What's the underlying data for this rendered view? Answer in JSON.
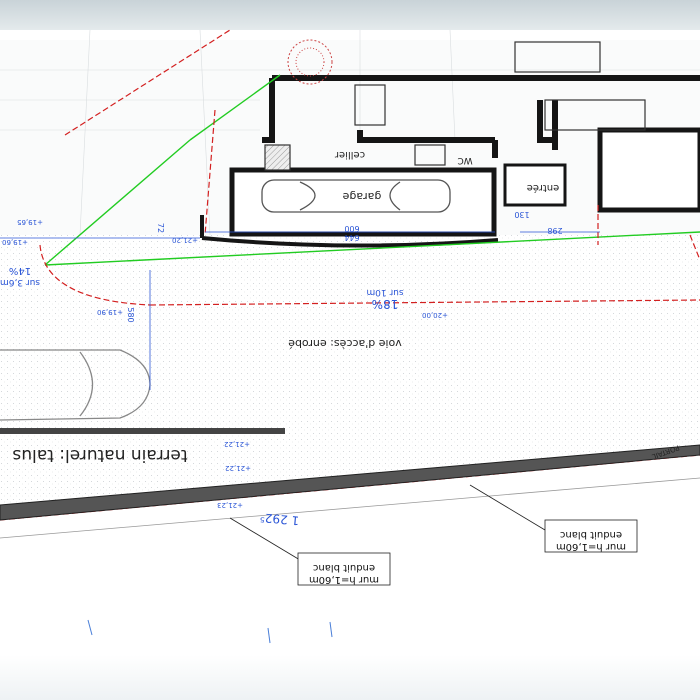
{
  "labels": {
    "garage": "garage",
    "cellier": "cellier",
    "wc": "WC",
    "entree": "entrée",
    "voie": "voie d'accès: enrobé",
    "terrain": "terrain naturel: talus",
    "portail": "PORTAIL",
    "slope1_pct": "18%",
    "slope1_len": "sur 10m",
    "slope2_pct": "14%",
    "slope2_len": "sur 3,6m",
    "dim_644": "644",
    "dim_600": "600",
    "dim_130": "130",
    "dim_298": "298",
    "dim_1292": "1 292⁵",
    "dim_580": "580",
    "dim_72": "72",
    "lvl_2122a": "+21,22",
    "lvl_2122b": "+21,22",
    "lvl_2120": "+21,20",
    "lvl_2123": "+21,23",
    "lvl_2000": "+20,00",
    "lvl_1965": "+19,65",
    "lvl_1990": "+19,90",
    "lvl_1960": "+19,60",
    "mur1_l1": "mur h=1,60m",
    "mur1_l2": "enduit blanc",
    "mur2_l1": "mur h=1,60m",
    "mur2_l2": "enduit blanc"
  },
  "colors": {
    "wall": "#151515",
    "green_line": "#22cc22",
    "red_dash": "#d32020",
    "dim_blue": "#2a55d6",
    "paving": "#cfd3d6"
  },
  "icons": {
    "car_garage": "car-outline-icon",
    "car_drive": "car-outline-icon",
    "tree": "tree-symbol-icon"
  }
}
